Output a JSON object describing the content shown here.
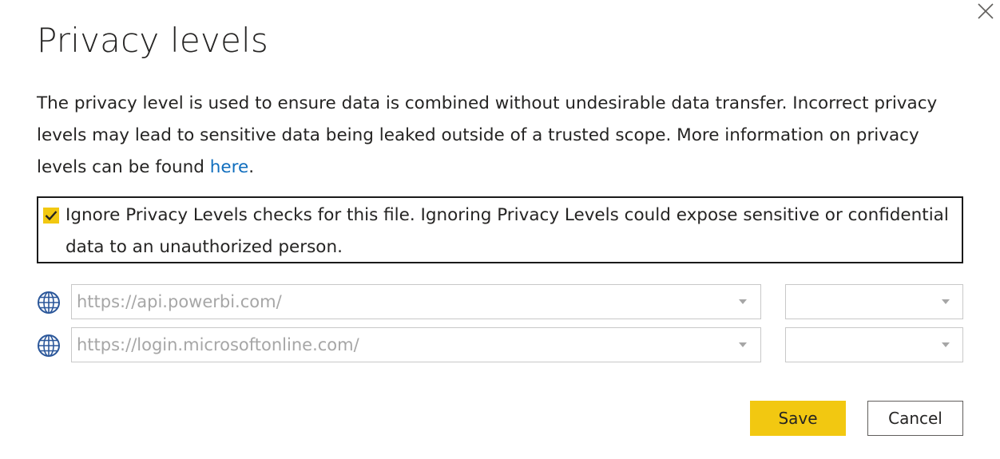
{
  "dialog": {
    "title": "Privacy levels",
    "description_text": "The privacy level is used to ensure data is combined without undesirable data transfer. Incorrect privacy levels may lead to sensitive data being leaked outside of a trusted scope. More information on privacy levels can be found ",
    "description_link": "here",
    "description_end": "."
  },
  "ignore_checkbox": {
    "checked": true,
    "label": "Ignore Privacy Levels checks for this file. Ignoring Privacy Levels could expose sensitive or confidential data to an unauthorized person."
  },
  "sources": [
    {
      "icon": "globe-icon",
      "url": "https://api.powerbi.com/",
      "level": ""
    },
    {
      "icon": "globe-icon",
      "url": "https://login.microsoftonline.com/",
      "level": ""
    }
  ],
  "buttons": {
    "save_label": "Save",
    "cancel_label": "Cancel"
  },
  "colors": {
    "accent": "#f2c811",
    "link": "#106ebe",
    "disabled_text": "#a6a6a6"
  }
}
